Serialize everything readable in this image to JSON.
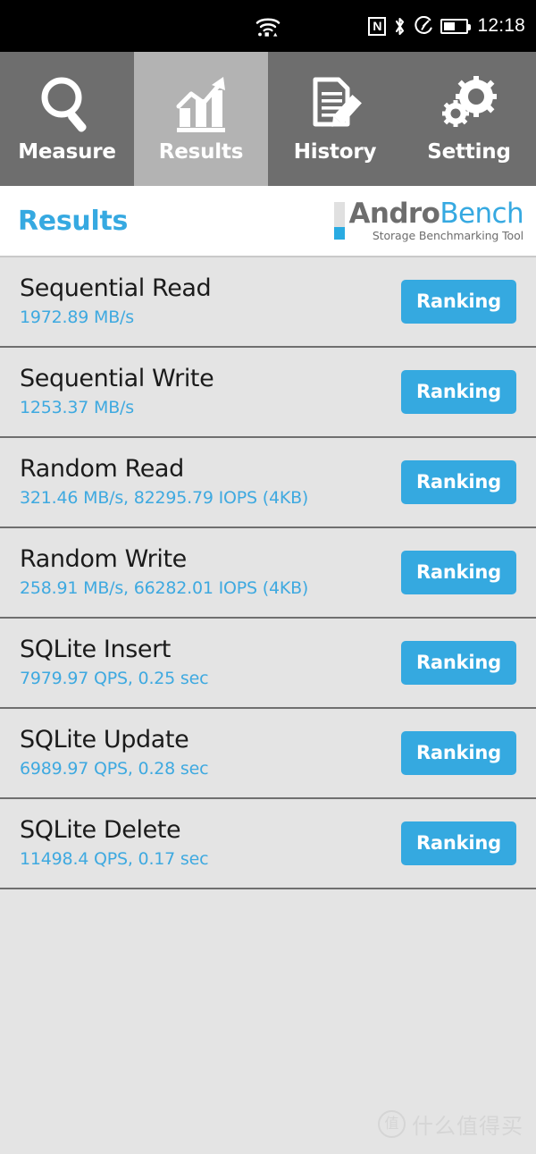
{
  "statusbar": {
    "wifi_icon": "wifi-icon",
    "nfc_icon": "nfc-icon",
    "nfc_glyph": "N",
    "bluetooth_icon": "bluetooth-icon",
    "dnd_icon": "dnd-icon",
    "battery_icon": "battery-icon",
    "battery_percent": 52,
    "time": "12:18"
  },
  "tabs": [
    {
      "label": "Measure",
      "icon": "magnifier-icon",
      "selected": false
    },
    {
      "label": "Results",
      "icon": "bar-chart-icon",
      "selected": true
    },
    {
      "label": "History",
      "icon": "document-pencil-icon",
      "selected": false
    },
    {
      "label": "Setting",
      "icon": "gears-icon",
      "selected": false
    }
  ],
  "header": {
    "title": "Results",
    "logo": {
      "word_part1": "Andro",
      "word_part2": "Bench",
      "subtitle": "Storage Benchmarking Tool"
    }
  },
  "results": {
    "ranking_label": "Ranking",
    "rows": [
      {
        "name": "Sequential Read",
        "value": "1972.89 MB/s"
      },
      {
        "name": "Sequential Write",
        "value": "1253.37 MB/s"
      },
      {
        "name": "Random Read",
        "value": "321.46 MB/s, 82295.79 IOPS (4KB)"
      },
      {
        "name": "Random Write",
        "value": "258.91 MB/s, 66282.01 IOPS (4KB)"
      },
      {
        "name": "SQLite Insert",
        "value": "7979.97 QPS, 0.25 sec"
      },
      {
        "name": "SQLite Update",
        "value": "6989.97 QPS, 0.28 sec"
      },
      {
        "name": "SQLite Delete",
        "value": "11498.4 QPS, 0.17 sec"
      }
    ]
  },
  "watermark": {
    "badge": "值",
    "text": "什么值得买"
  },
  "colors": {
    "accent_blue": "#36a9e1",
    "button_blue": "#35a9e0",
    "tab_bg": "#6e6e6e",
    "tab_selected_bg": "#b3b3b3",
    "list_bg": "#e4e4e4",
    "row_divider": "#6f6f6f",
    "statusbar_bg": "#000000"
  }
}
